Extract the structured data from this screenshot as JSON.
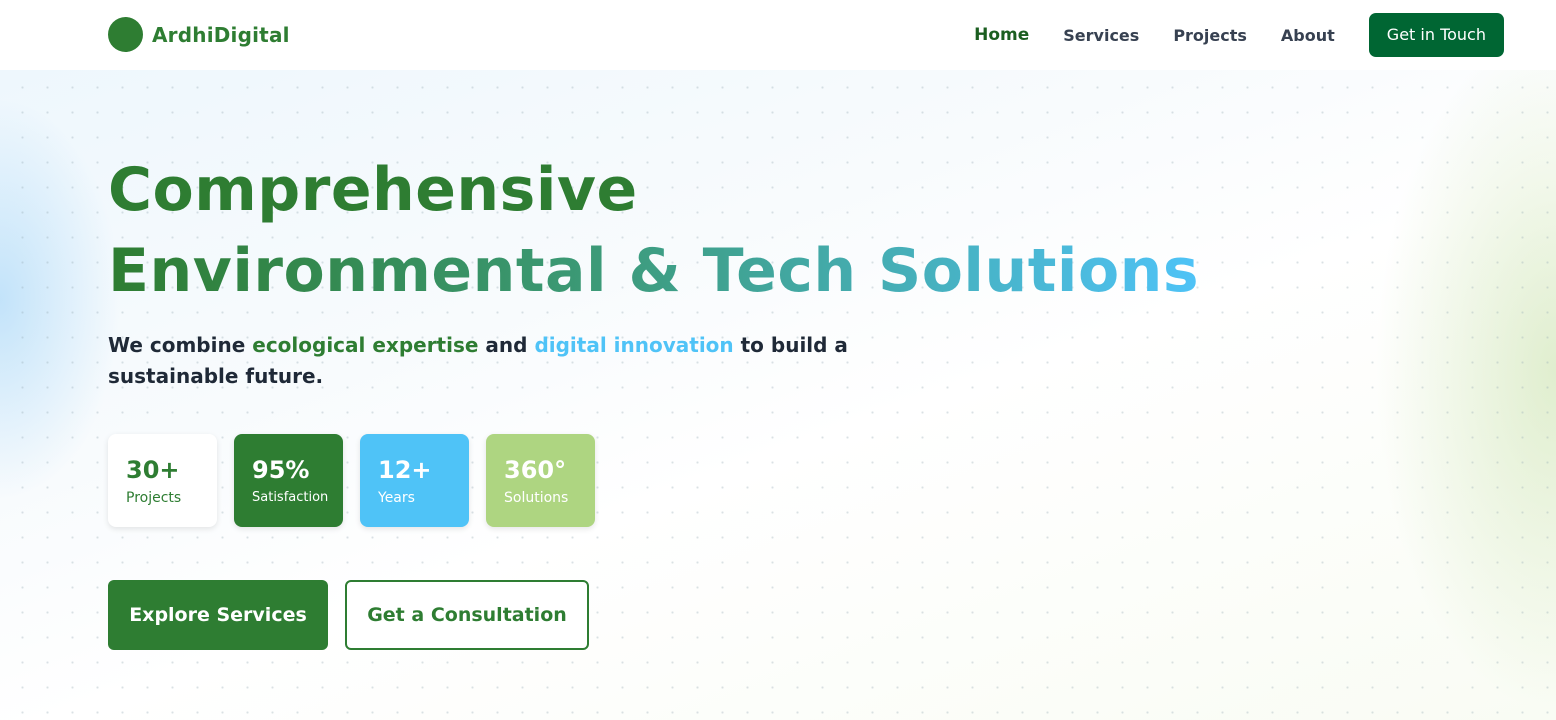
{
  "nav": {
    "brand": "ArdhiDigital",
    "links": [
      "Home",
      "Services",
      "Projects",
      "About"
    ],
    "cta": "Get in Touch"
  },
  "hero": {
    "headline_line1": "Comprehensive",
    "headline_line2": "Environmental & Tech Solutions",
    "subtitle": {
      "part1": "We combine ",
      "highlight1": "ecological expertise",
      "part2": " and ",
      "highlight2": "digital innovation",
      "part3": " to build a sustainable future."
    },
    "stats": [
      {
        "value": "30+",
        "label": "Projects"
      },
      {
        "value": "95%",
        "label": "Satisfaction"
      },
      {
        "value": "12+",
        "label": "Years"
      },
      {
        "value": "360°",
        "label": "Solutions"
      }
    ],
    "buttons": {
      "primary": "Explore Services",
      "secondary": "Get a Consultation"
    }
  },
  "colors": {
    "brand_green": "#2e7d32",
    "dark_green": "#006633",
    "sky_blue": "#4fc3f7",
    "light_green": "#aed581"
  },
  "icons": {
    "logo": "green-circle-logo-icon"
  }
}
